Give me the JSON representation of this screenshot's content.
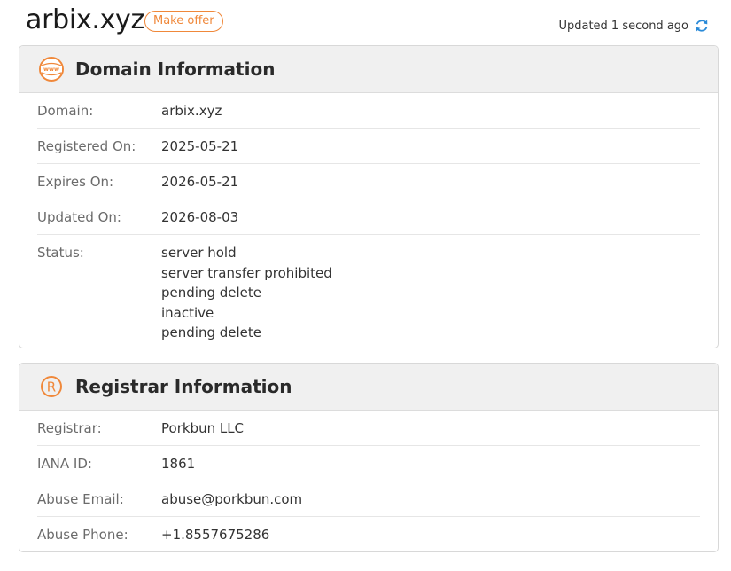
{
  "header": {
    "domain": "arbix.xyz",
    "offer_label": "Make offer",
    "updated_text": "Updated 1 second ago",
    "refresh_icon": "refresh-icon"
  },
  "domain_info": {
    "title": "Domain Information",
    "icon": "www-icon",
    "rows": [
      {
        "label": "Domain:",
        "value": "arbix.xyz"
      },
      {
        "label": "Registered On:",
        "value": "2025-05-21"
      },
      {
        "label": "Expires On:",
        "value": "2026-05-21"
      },
      {
        "label": "Updated On:",
        "value": "2026-08-03"
      }
    ],
    "status_label": "Status:",
    "status_values": [
      "server hold",
      "server transfer prohibited",
      "pending delete",
      "inactive",
      "pending delete"
    ]
  },
  "registrar_info": {
    "title": "Registrar Information",
    "icon": "registered-icon",
    "rows": [
      {
        "label": "Registrar:",
        "value": "Porkbun LLC"
      },
      {
        "label": "IANA ID:",
        "value": "1861"
      },
      {
        "label": "Abuse Email:",
        "value": "abuse@porkbun.com"
      },
      {
        "label": "Abuse Phone:",
        "value": "+1.8557675286"
      }
    ]
  },
  "colors": {
    "accent": "#f0883a",
    "refresh": "#2a8ad8",
    "header_bg": "#f0f0f0"
  }
}
